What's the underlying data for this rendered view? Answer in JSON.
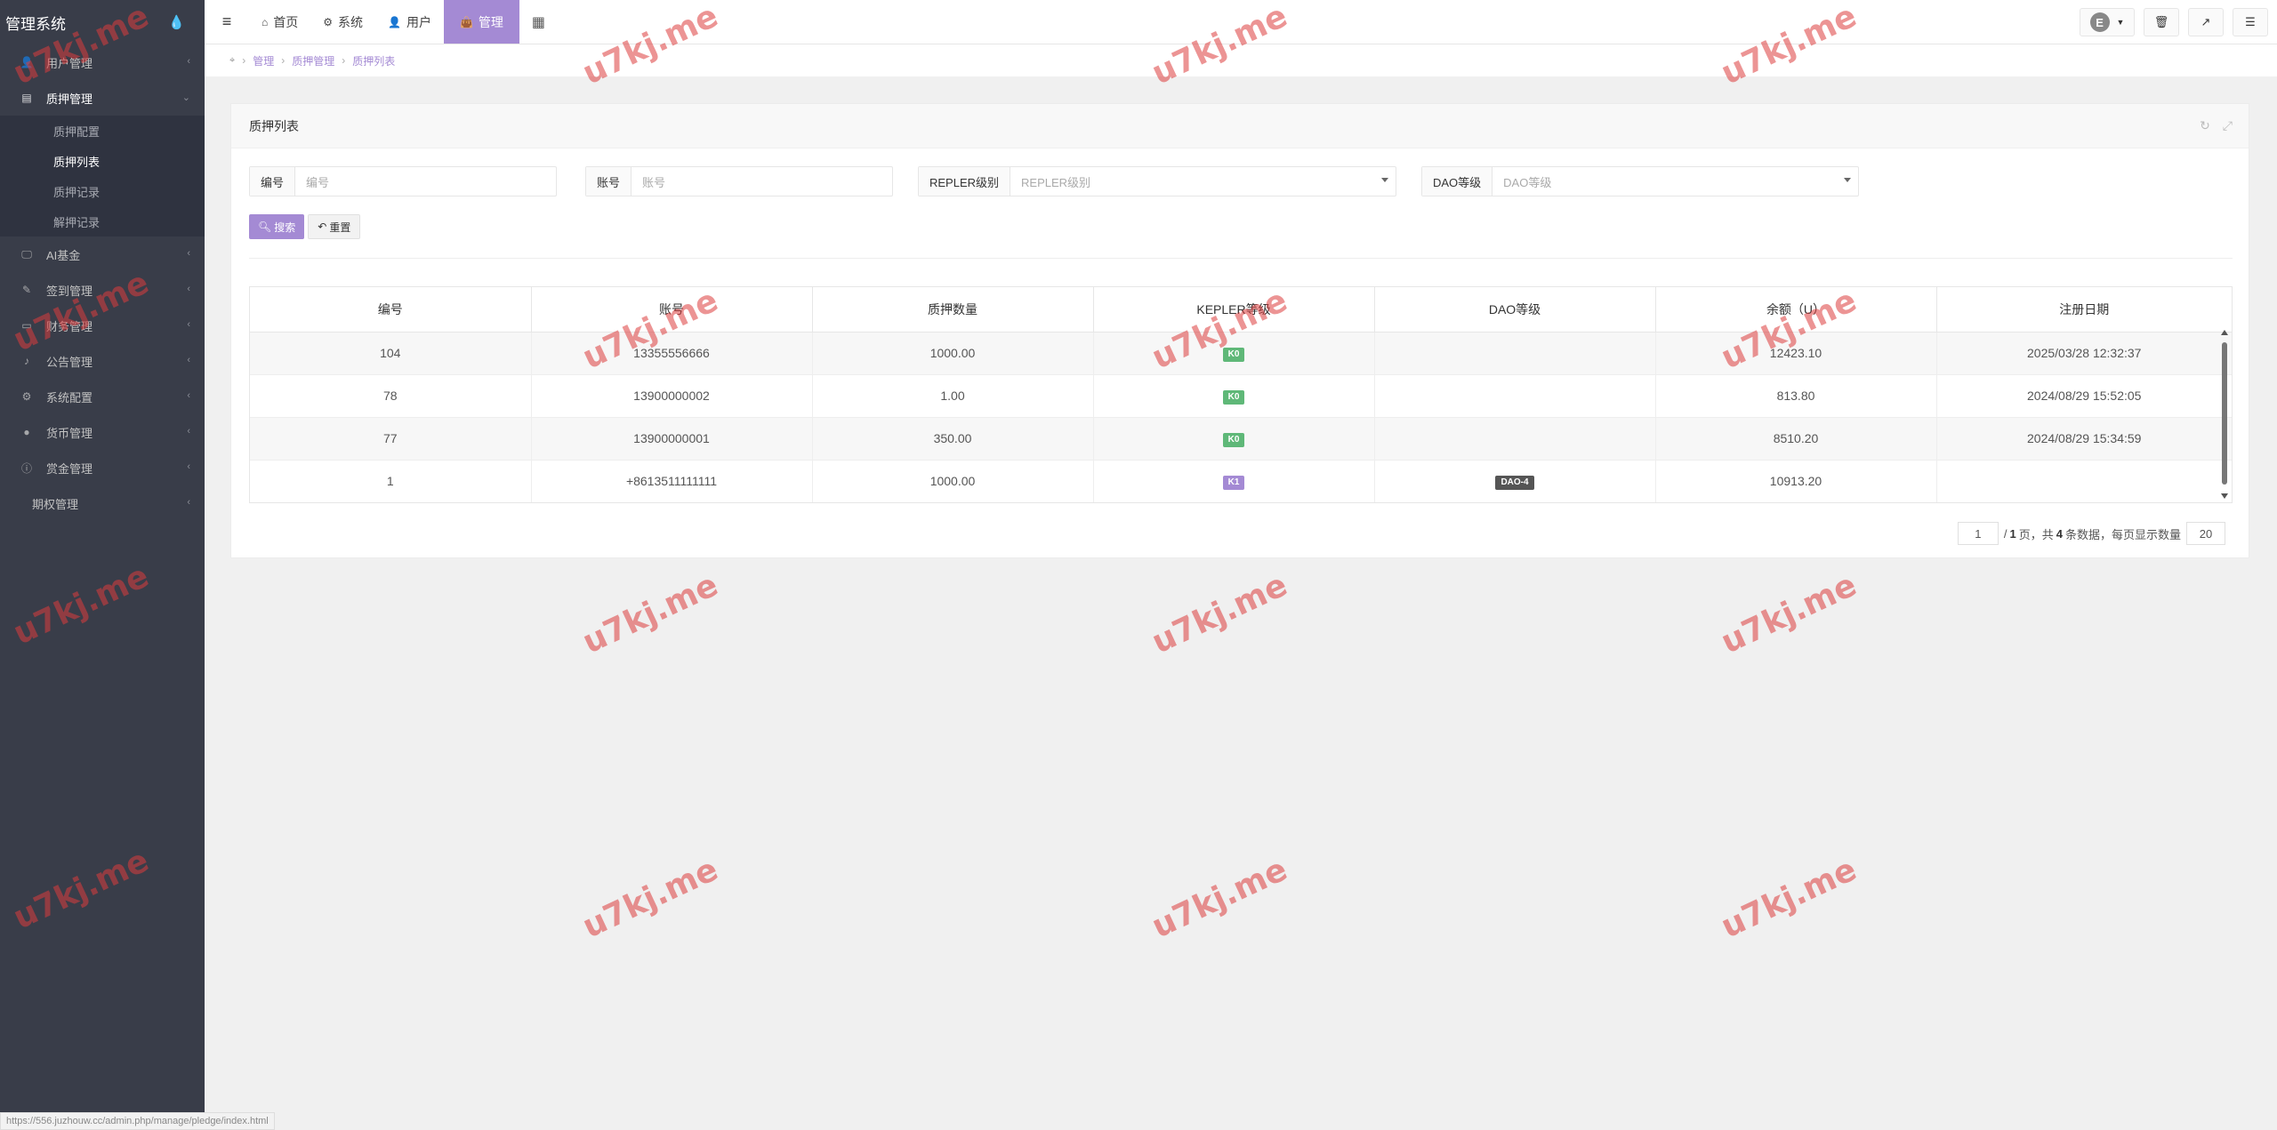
{
  "sidebar": {
    "title": "管理系统",
    "menu": [
      {
        "label": "用户管理",
        "icon": "user-icon"
      },
      {
        "label": "质押管理",
        "icon": "table-icon",
        "active": true,
        "children": [
          {
            "label": "质押配置"
          },
          {
            "label": "质押列表",
            "active": true
          },
          {
            "label": "质押记录"
          },
          {
            "label": "解押记录"
          }
        ]
      },
      {
        "label": "AI基金",
        "icon": "monitor-icon"
      },
      {
        "label": "签到管理",
        "icon": "edit-icon"
      },
      {
        "label": "财务管理",
        "icon": "card-icon"
      },
      {
        "label": "公告管理",
        "icon": "bell-icon"
      },
      {
        "label": "系统配置",
        "icon": "cogs-icon"
      },
      {
        "label": "货币管理",
        "icon": "coin-icon"
      },
      {
        "label": "赏金管理",
        "icon": "info-icon"
      },
      {
        "label": "期权管理",
        "icon": ""
      }
    ]
  },
  "topbar": {
    "tabs": [
      {
        "label": "首页",
        "icon": "home-icon"
      },
      {
        "label": "系统",
        "icon": "gear-icon"
      },
      {
        "label": "用户",
        "icon": "user-icon"
      },
      {
        "label": "管理",
        "icon": "briefcase-icon",
        "active": true
      }
    ],
    "avatar_letter": "E"
  },
  "breadcrumb": [
    "管理",
    "质押管理",
    "质押列表"
  ],
  "panel": {
    "title": "质押列表",
    "filters": [
      {
        "label": "编号",
        "placeholder": "编号"
      },
      {
        "label": "账号",
        "placeholder": "账号"
      },
      {
        "label": "REPLER级别",
        "placeholder": "REPLER级别"
      },
      {
        "label": "DAO等级",
        "placeholder": "DAO等级"
      }
    ],
    "search_label": "搜索",
    "reset_label": "重置"
  },
  "table": {
    "headers": [
      "编号",
      "账号",
      "质押数量",
      "KEPLER等级",
      "DAO等级",
      "余额（U）",
      "注册日期"
    ],
    "rows": [
      {
        "id": "104",
        "account": "13355556666",
        "amount": "1000.00",
        "kepler": "K0",
        "dao": "",
        "balance": "12423.10",
        "date": "2025/03/28 12:32:37"
      },
      {
        "id": "78",
        "account": "13900000002",
        "amount": "1.00",
        "kepler": "K0",
        "dao": "",
        "balance": "813.80",
        "date": "2024/08/29 15:52:05"
      },
      {
        "id": "77",
        "account": "13900000001",
        "amount": "350.00",
        "kepler": "K0",
        "dao": "",
        "balance": "8510.20",
        "date": "2024/08/29 15:34:59"
      },
      {
        "id": "1",
        "account": "+8613511111111",
        "amount": "1000.00",
        "kepler": "K1",
        "dao": "DAO-4",
        "balance": "10913.20",
        "date": ""
      }
    ]
  },
  "pager": {
    "current": "1",
    "text1": "/",
    "total_pages": "1",
    "text2": "页，共",
    "total_records": "4",
    "text3": "条数据，每页显示数量",
    "page_size": "20"
  },
  "statusbar": "https://556.juzhouw.cc/admin.php/manage/pledge/index.html",
  "watermark": "u7kj.me"
}
